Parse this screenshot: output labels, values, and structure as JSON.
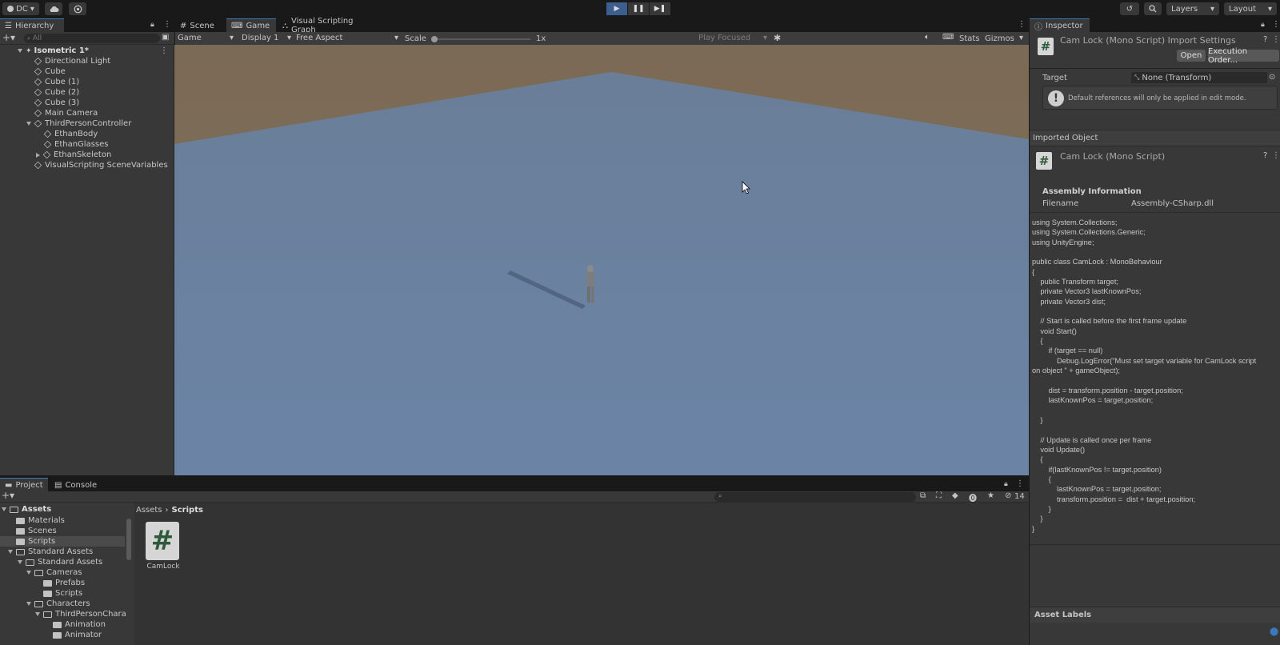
{
  "toolbar": {
    "account": "DC",
    "layers": "Layers",
    "layout": "Layout"
  },
  "hierarchy": {
    "tab": "Hierarchy",
    "search_placeholder": "All",
    "scene": "Isometric 1*",
    "items": [
      {
        "label": "Directional Light"
      },
      {
        "label": "Cube"
      },
      {
        "label": "Cube (1)"
      },
      {
        "label": "Cube (2)"
      },
      {
        "label": "Cube (3)"
      },
      {
        "label": "Main Camera"
      },
      {
        "label": "ThirdPersonController"
      },
      {
        "label": "EthanBody"
      },
      {
        "label": "EthanGlasses"
      },
      {
        "label": "EthanSkeleton"
      },
      {
        "label": "VisualScripting SceneVariables"
      }
    ]
  },
  "center_tabs": [
    {
      "label": "Scene"
    },
    {
      "label": "Game"
    },
    {
      "label": "Visual Scripting Graph"
    }
  ],
  "game_bar": {
    "mode": "Game",
    "display": "Display 1",
    "aspect": "Free Aspect",
    "scale_label": "Scale",
    "scale_value": "1x",
    "play_focused": "Play Focused",
    "stats": "Stats",
    "gizmos": "Gizmos"
  },
  "inspector": {
    "tab": "Inspector",
    "title": "Cam Lock (Mono Script) Import Settings",
    "open_btn": "Open",
    "exec_btn": "Execution Order...",
    "target_label": "Target",
    "target_value": "None (Transform)",
    "help": "Default references will only be applied in edit mode.",
    "imported_object": "Imported Object",
    "script_name": "Cam Lock (Mono Script)",
    "assembly_info": "Assembly Information",
    "filename_label": "Filename",
    "filename_value": "Assembly-CSharp.dll",
    "code_lines": [
      "using System.Collections;",
      "using System.Collections.Generic;",
      "using UnityEngine;",
      "",
      "public class CamLock : MonoBehaviour",
      "{",
      "    public Transform target;",
      "    private Vector3 lastKnownPos;",
      "    private Vector3 dist;",
      "",
      "    // Start is called before the first frame update",
      "    void Start()",
      "    {",
      "        if (target == null)",
      "            Debug.LogError(\"Must set target variable for CamLock script",
      "on object \" + gameObject);",
      "",
      "        dist = transform.position - target.position;",
      "        lastKnownPos = target.position;",
      "",
      "    }",
      "",
      "    // Update is called once per frame",
      "    void Update()",
      "    {",
      "        if(lastKnownPos != target.position)",
      "        {",
      "            lastKnownPos = target.position;",
      "            transform.position =  dist + target.position;",
      "        }",
      "    }",
      "}"
    ],
    "asset_labels": "Asset Labels"
  },
  "project": {
    "tabs": [
      {
        "label": "Project"
      },
      {
        "label": "Console"
      }
    ],
    "hidden_count": "14",
    "breadcrumb": [
      "Assets",
      "Scripts"
    ],
    "tree": [
      {
        "label": "Assets"
      },
      {
        "label": "Materials"
      },
      {
        "label": "Scenes"
      },
      {
        "label": "Scripts"
      },
      {
        "label": "Standard Assets"
      },
      {
        "label": "Standard Assets"
      },
      {
        "label": "Cameras"
      },
      {
        "label": "Prefabs"
      },
      {
        "label": "Scripts"
      },
      {
        "label": "Characters"
      },
      {
        "label": "ThirdPersonChara"
      },
      {
        "label": "Animation"
      },
      {
        "label": "Animator"
      }
    ],
    "asset": "CamLock"
  },
  "colors": {
    "accent": "#3a79bb",
    "ground": "#6c84a3",
    "sky": "#7d6a53"
  }
}
